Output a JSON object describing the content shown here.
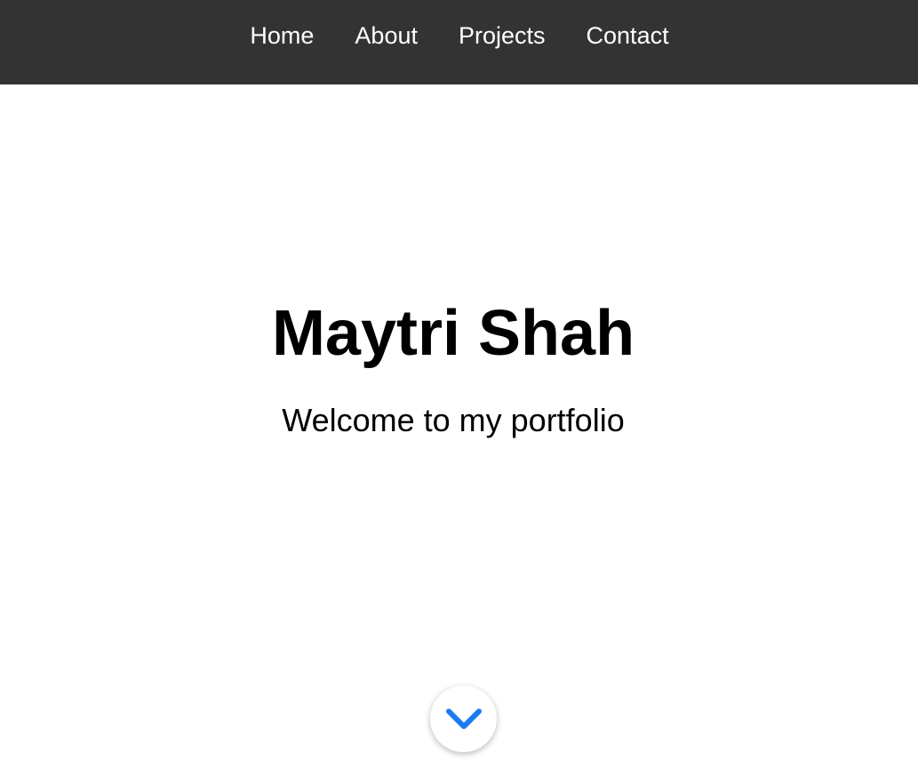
{
  "nav": {
    "items": [
      {
        "label": "Home"
      },
      {
        "label": "About"
      },
      {
        "label": "Projects"
      },
      {
        "label": "Contact"
      }
    ]
  },
  "hero": {
    "title": "Maytri Shah",
    "subtitle": "Welcome to my portfolio"
  },
  "scroll_button": {
    "icon": "chevron-down-icon",
    "color": "#1a7cf0"
  },
  "colors": {
    "navbar_background": "#333333",
    "nav_text": "#ffffff",
    "page_background": "#ffffff",
    "text": "#000000",
    "accent": "#1a7cf0"
  }
}
